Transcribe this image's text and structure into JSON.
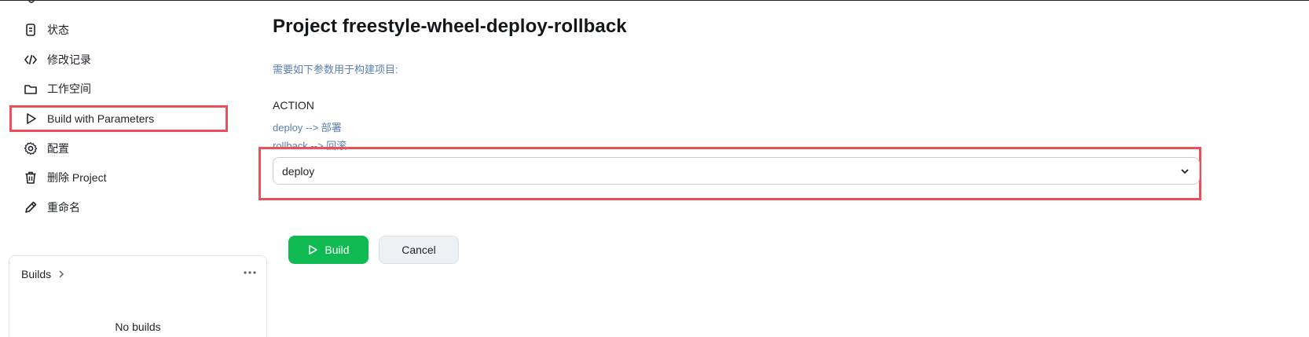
{
  "sidebar": {
    "items": [
      {
        "label": "状态",
        "icon": "document-icon"
      },
      {
        "label": "修改记录",
        "icon": "code-icon"
      },
      {
        "label": "工作空间",
        "icon": "folder-icon"
      },
      {
        "label": "Build with Parameters",
        "icon": "play-icon",
        "active": true
      },
      {
        "label": "配置",
        "icon": "gear-icon"
      },
      {
        "label": "删除 Project",
        "icon": "trash-icon"
      },
      {
        "label": "重命名",
        "icon": "pencil-icon"
      }
    ],
    "builds": {
      "title": "Builds",
      "empty_text": "No builds"
    }
  },
  "main": {
    "title": "Project freestyle-wheel-deploy-rollback",
    "intro": "需要如下参数用于构建项目:",
    "parameter": {
      "name": "ACTION",
      "description_lines": [
        "deploy --> 部署",
        "rollback --> 回滚"
      ],
      "selected_value": "deploy"
    },
    "buttons": {
      "build_label": "Build",
      "cancel_label": "Cancel"
    }
  },
  "colors": {
    "accent_green": "#0fba52",
    "highlight_red": "#e8515a",
    "description_blue": "#5a7fb0"
  }
}
